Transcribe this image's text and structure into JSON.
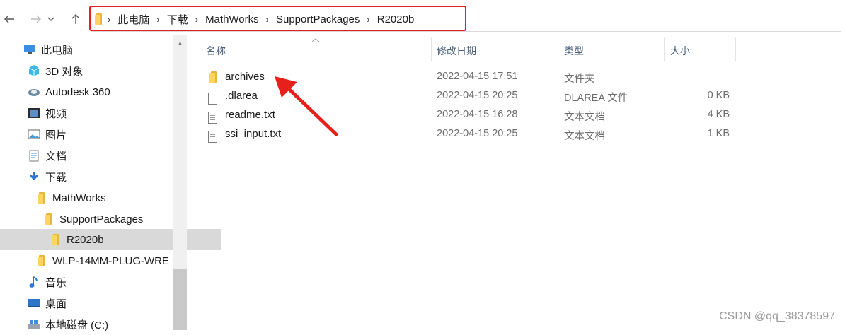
{
  "address": {
    "crumbs": [
      "此电脑",
      "下载",
      "MathWorks",
      "SupportPackages",
      "R2020b"
    ],
    "highlight_color": "#e8201b"
  },
  "sidebar": {
    "items": [
      {
        "label": "此电脑",
        "icon": "pc-icon"
      },
      {
        "label": "3D 对象",
        "icon": "3d-objects-icon"
      },
      {
        "label": "Autodesk 360",
        "icon": "cloud-icon"
      },
      {
        "label": "视频",
        "icon": "video-icon"
      },
      {
        "label": "图片",
        "icon": "pictures-icon"
      },
      {
        "label": "文档",
        "icon": "documents-icon"
      },
      {
        "label": "下载",
        "icon": "download-icon"
      },
      {
        "label": "MathWorks",
        "icon": "folder-icon"
      },
      {
        "label": "SupportPackages",
        "icon": "folder-icon"
      },
      {
        "label": "R2020b",
        "icon": "folder-icon",
        "selected": true
      },
      {
        "label": "WLP-14MM-PLUG-WRE",
        "icon": "folder-icon"
      },
      {
        "label": "音乐",
        "icon": "music-icon"
      },
      {
        "label": "桌面",
        "icon": "desktop-icon"
      },
      {
        "label": "本地磁盘 (C:)",
        "icon": "drive-icon"
      }
    ]
  },
  "columns": {
    "name": "名称",
    "date": "修改日期",
    "type": "类型",
    "size": "大小"
  },
  "files": [
    {
      "name": "archives",
      "date": "2022-04-15 17:51",
      "type": "文件夹",
      "size": "",
      "icon": "folder-icon"
    },
    {
      "name": ".dlarea",
      "date": "2022-04-15 20:25",
      "type": "DLAREA 文件",
      "size": "0 KB",
      "icon": "file-icon"
    },
    {
      "name": "readme.txt",
      "date": "2022-04-15 16:28",
      "type": "文本文档",
      "size": "4 KB",
      "icon": "text-file-icon"
    },
    {
      "name": "ssi_input.txt",
      "date": "2022-04-15 20:25",
      "type": "文本文档",
      "size": "1 KB",
      "icon": "text-file-icon"
    }
  ],
  "annotation": {
    "arrow_color": "#e8201b"
  },
  "watermark": "CSDN @qq_38378597"
}
